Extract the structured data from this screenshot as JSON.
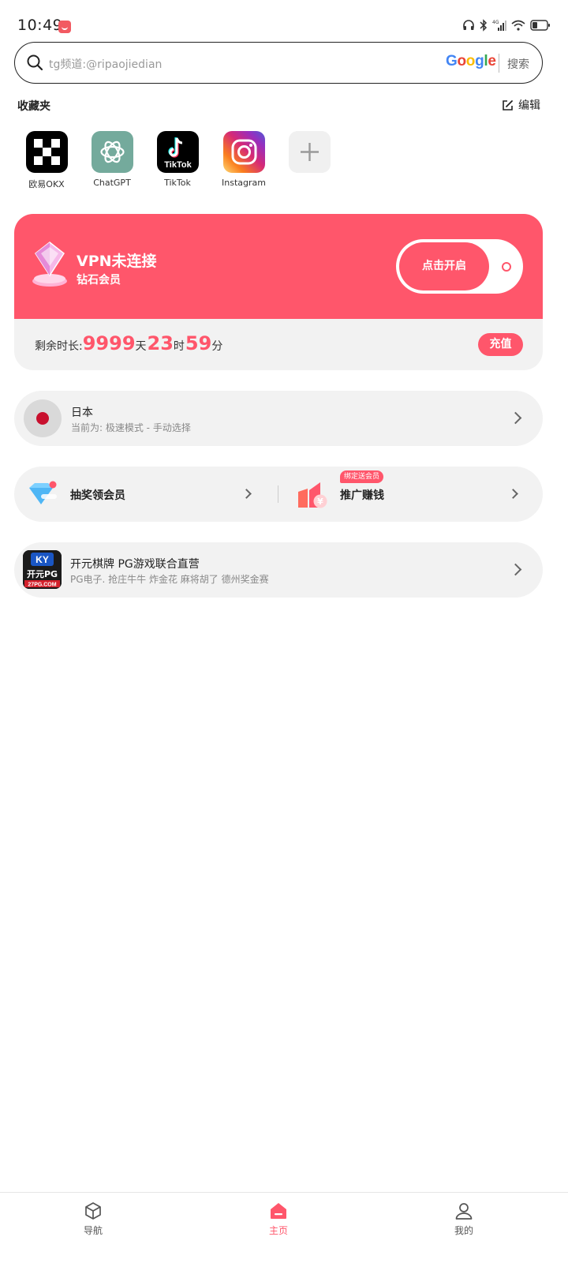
{
  "status_bar": {
    "time": "10:49"
  },
  "search": {
    "placeholder": "tg频道:@ripaojiedian",
    "engine_logo": "Google",
    "button_label": "搜索"
  },
  "favorites": {
    "title": "收藏夹",
    "edit_label": "编辑",
    "items": [
      {
        "label": "欧易OKX",
        "icon": "okx-icon"
      },
      {
        "label": "ChatGPT",
        "icon": "chatgpt-icon"
      },
      {
        "label": "TikTok",
        "icon": "tiktok-icon"
      },
      {
        "label": "Instagram",
        "icon": "instagram-icon"
      },
      {
        "label": "",
        "icon": "add-icon"
      }
    ]
  },
  "vpn": {
    "status": "VPN未连接",
    "membership": "钻石会员",
    "connect_label": "点击开启",
    "remaining_label": "剩余时长:",
    "days": "9999",
    "days_unit": "天",
    "hours": "23",
    "hours_unit": "时",
    "minutes": "59",
    "minutes_unit": "分",
    "recharge_label": "充值"
  },
  "node": {
    "name": "日本",
    "mode": "当前为: 极速模式 - 手动选择"
  },
  "promo": {
    "lottery_label": "抽奖领会员",
    "referral_label": "推广赚钱",
    "referral_tag": "绑定送会员"
  },
  "ad": {
    "title": "开元棋牌 PG游戏联合直营",
    "subtitle": "PG电子. 抢庄牛牛 炸金花  麻将胡了 德州奖金赛",
    "logo_top": "KY",
    "logo_mid": "开元PG",
    "logo_bottom": "27PG.COM"
  },
  "bottom_nav": {
    "items": [
      {
        "label": "导航"
      },
      {
        "label": "主页"
      },
      {
        "label": "我的"
      }
    ],
    "active": "主页"
  },
  "colors": {
    "accent": "#ff566b",
    "card_bg": "#f2f2f2"
  }
}
